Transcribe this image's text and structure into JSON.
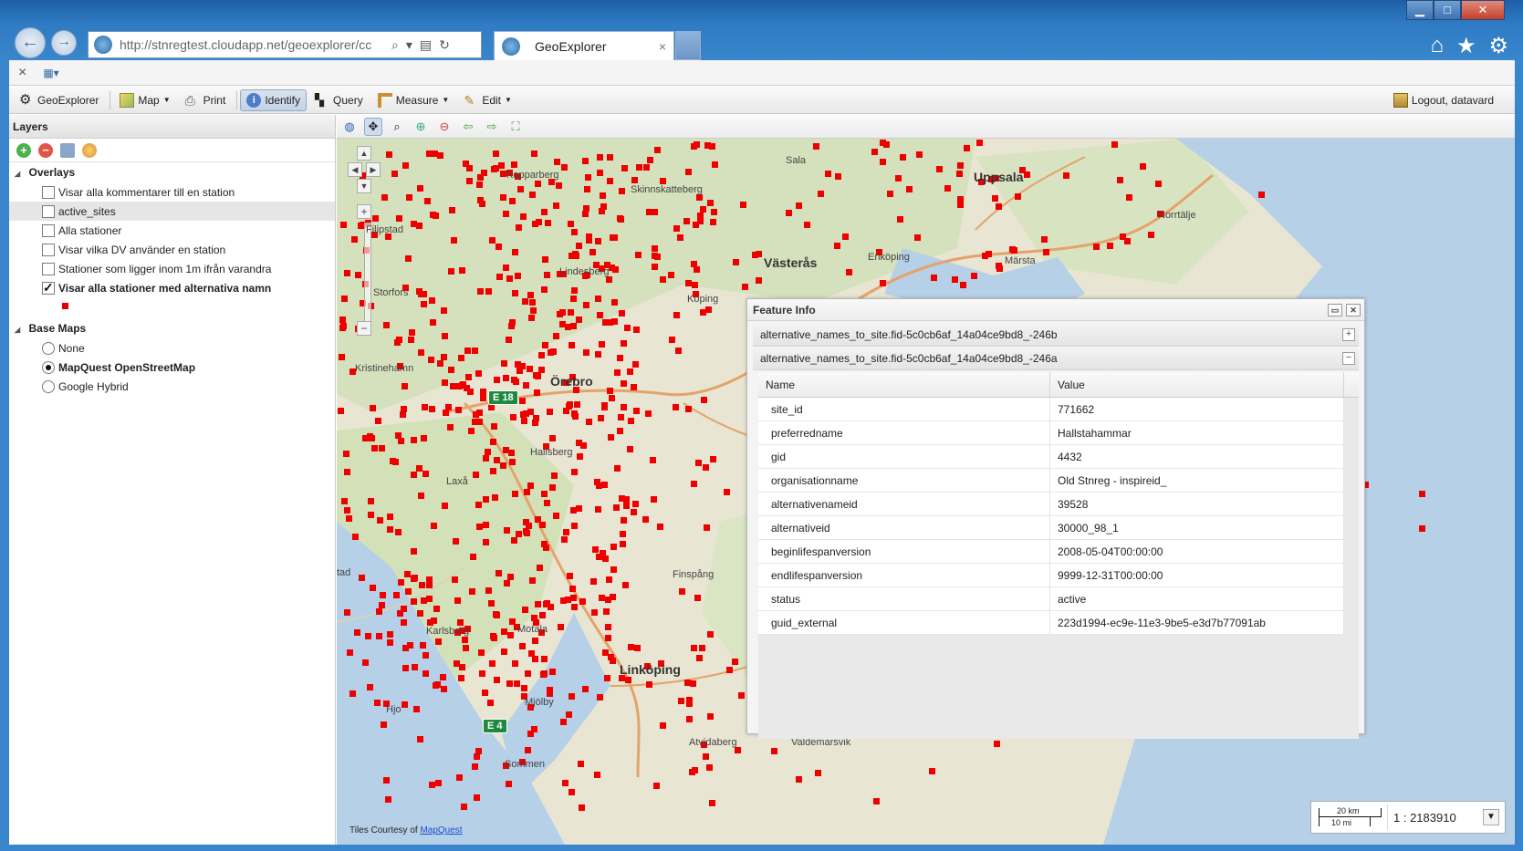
{
  "browser": {
    "url": "http://stnregtest.cloudapp.net/geoexplorer/cc",
    "tab_title": "GeoExplorer",
    "tab_close": "×",
    "cmd_close": "×"
  },
  "window_buttons": {
    "minimize": "▁",
    "maximize": "□",
    "close": "✕"
  },
  "toolbar": {
    "items": [
      {
        "label": "GeoExplorer"
      },
      {
        "label": "Map"
      },
      {
        "label": "Print"
      },
      {
        "label": "Identify"
      },
      {
        "label": "Query"
      },
      {
        "label": "Measure"
      },
      {
        "label": "Edit"
      }
    ],
    "logout_label": "Logout, datavard"
  },
  "layers": {
    "title": "Layers",
    "overlays_label": "Overlays",
    "overlays": [
      {
        "label": "Visar alla kommentarer till en station",
        "checked": false
      },
      {
        "label": "active_sites",
        "checked": false
      },
      {
        "label": "Alla stationer",
        "checked": false
      },
      {
        "label": "Visar vilka DV använder en station",
        "checked": false
      },
      {
        "label": "Stationer som ligger inom 1m ifrån varandra",
        "checked": false
      },
      {
        "label": "Visar alla stationer med alternativa namn",
        "checked": true
      }
    ],
    "legend_color": "#e00000",
    "basemaps_label": "Base Maps",
    "basemaps": [
      {
        "label": "None",
        "selected": false
      },
      {
        "label": "MapQuest OpenStreetMap",
        "selected": true
      },
      {
        "label": "Google Hybrid",
        "selected": false
      }
    ]
  },
  "map": {
    "places": [
      {
        "name": "Sala"
      },
      {
        "name": "Uppsala"
      },
      {
        "name": "Skinnskatteberg"
      },
      {
        "name": "Kopparberg"
      },
      {
        "name": "Norrtälje"
      },
      {
        "name": "Västerås"
      },
      {
        "name": "Enköping"
      },
      {
        "name": "Märsta"
      },
      {
        "name": "Filipstad"
      },
      {
        "name": "Lindesberg"
      },
      {
        "name": "Storfors"
      },
      {
        "name": "Köping"
      },
      {
        "name": "Kristinehamn"
      },
      {
        "name": "Örebro"
      },
      {
        "name": "Hallsberg"
      },
      {
        "name": "Laxå"
      },
      {
        "name": "Finspång"
      },
      {
        "name": "Karlsborg"
      },
      {
        "name": "Motala"
      },
      {
        "name": "Linköping"
      },
      {
        "name": "Mjölby"
      },
      {
        "name": "Hjo"
      },
      {
        "name": "Atvidaberg"
      },
      {
        "name": "Valdemarsvik"
      },
      {
        "name": "Sommen"
      },
      {
        "name": "tad"
      }
    ],
    "road_labels": [
      "E 18",
      "E 4"
    ],
    "attribution_prefix": "Tiles Courtesy of ",
    "attribution_link": "MapQuest",
    "scale_km": "20 km",
    "scale_mi": "10 mi",
    "scale_ratio": "1 : 2183910",
    "marker_color": "#ee0000"
  },
  "feature_info": {
    "title": "Feature Info",
    "groups": [
      {
        "label": "alternative_names_to_site.fid-5c0cb6af_14a04ce9bd8_-246b",
        "toggle": "+"
      },
      {
        "label": "alternative_names_to_site.fid-5c0cb6af_14a04ce9bd8_-246a",
        "toggle": "−"
      }
    ],
    "columns": {
      "name": "Name",
      "value": "Value"
    },
    "rows": [
      {
        "name": "site_id",
        "value": "771662"
      },
      {
        "name": "preferredname",
        "value": "Hallstahammar"
      },
      {
        "name": "gid",
        "value": "4432"
      },
      {
        "name": "organisationname",
        "value": "Old Stnreg - inspireid_"
      },
      {
        "name": "alternativenameid",
        "value": "39528"
      },
      {
        "name": "alternativeid",
        "value": "30000_98_1"
      },
      {
        "name": "beginlifespanversion",
        "value": "2008-05-04T00:00:00"
      },
      {
        "name": "endlifespanversion",
        "value": "9999-12-31T00:00:00"
      },
      {
        "name": "status",
        "value": "active"
      },
      {
        "name": "guid_external",
        "value": "223d1994-ec9e-11e3-9be5-e3d7b77091ab"
      }
    ]
  }
}
